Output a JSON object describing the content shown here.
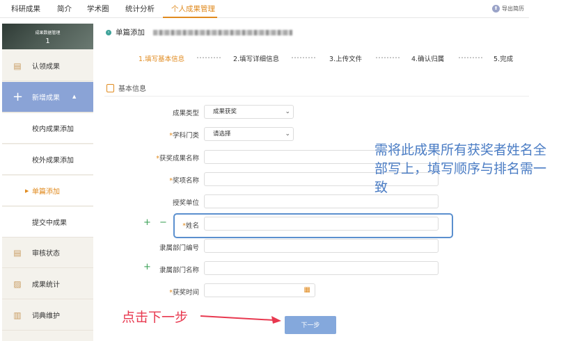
{
  "topnav": {
    "items": [
      "科研成果",
      "简介",
      "学术圈",
      "统计分析",
      "个人成果管理"
    ],
    "export_label": "导出简历"
  },
  "sidebar": {
    "header_title": "成果数据管理",
    "header_count": "1",
    "items": [
      {
        "label": "认领成果",
        "icon": "claim-icon"
      },
      {
        "label": "新增成果",
        "icon": "plus-icon"
      },
      {
        "label": "校内成果添加"
      },
      {
        "label": "校外成果添加"
      },
      {
        "label": "单篇添加"
      },
      {
        "label": "提交中成果"
      },
      {
        "label": "审核状态",
        "icon": "review-icon"
      },
      {
        "label": "成果统计",
        "icon": "chart-icon"
      },
      {
        "label": "词典维护",
        "icon": "dictionary-icon"
      }
    ]
  },
  "page": {
    "title": "单篇添加",
    "steps": [
      "1.填写基本信息",
      "2.填写详细信息",
      "3.上传文件",
      "4.确认归属",
      "5.完成"
    ],
    "section_title": "基本信息"
  },
  "form": {
    "result_type_label": "成果类型",
    "result_type_value": "成果获奖",
    "discipline_label": "学科门类",
    "discipline_value": "请选择",
    "award_name_label": "获奖成果名称",
    "prize_name_label": "奖项名称",
    "awarding_unit_label": "授奖单位",
    "name_label": "姓名",
    "dept_code_label": "隶属部门编号",
    "dept_name_label": "隶属部门名称",
    "award_time_label": "获奖时间",
    "required_mark": "*",
    "plus": "+",
    "minus": "−"
  },
  "annotations": {
    "callout": "需将此成果所有获奖者姓名全部写上，填写顺序与排名需一致",
    "next_hint": "点击下一步"
  },
  "buttons": {
    "next": "下一步"
  },
  "colors": {
    "accent": "#e08a1e",
    "sidebar_active": "#8aa3d6",
    "callout": "#4a7cc4",
    "hint": "#e8384f",
    "button": "#84a8dc"
  }
}
